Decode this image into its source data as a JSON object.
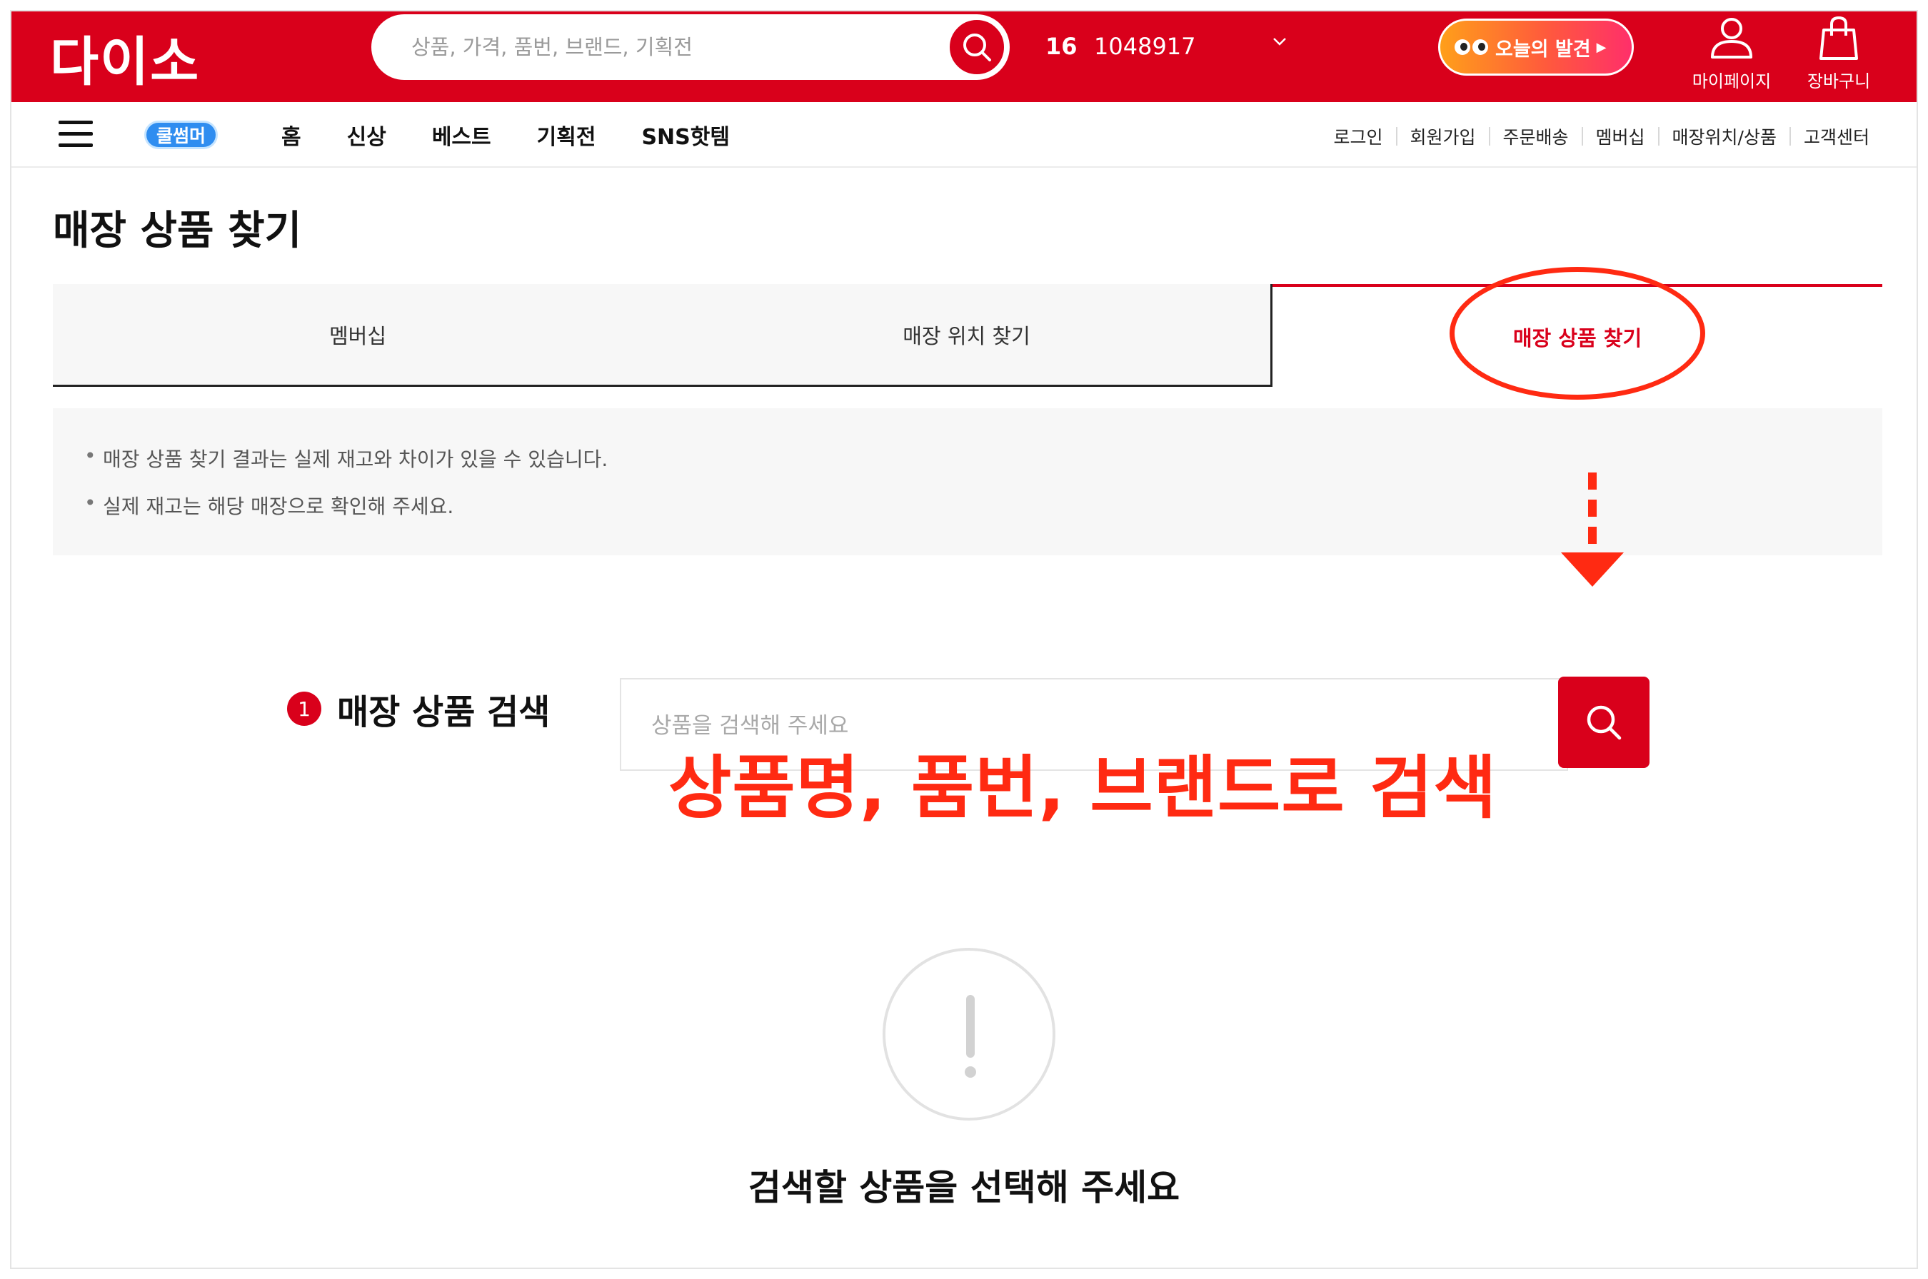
{
  "header": {
    "logo": "다이소",
    "search_placeholder": "상품, 가격, 품번, 브랜드, 기획전",
    "info_num1": "16",
    "info_num2": "1048917",
    "discover_label": "오늘의 발견",
    "mypage_label": "마이페이지",
    "cart_label": "장바구니"
  },
  "nav": {
    "promo_badge": "쿨썸머",
    "main": [
      "홈",
      "신상",
      "베스트",
      "기획전",
      "SNS핫템"
    ],
    "util": [
      "로그인",
      "회원가입",
      "주문배송",
      "멤버십",
      "매장위치/상품",
      "고객센터"
    ]
  },
  "page": {
    "title": "매장 상품 찾기",
    "tabs": [
      "멤버십",
      "매장 위치 찾기",
      "매장 상품 찾기"
    ],
    "active_tab": 2,
    "notices": [
      "매장 상품 찾기 결과는 실제 재고와 차이가 있을 수 있습니다.",
      "실제 재고는 해당 매장으로 확인해 주세요."
    ]
  },
  "search_section": {
    "step_number": "1",
    "label": "매장 상품 검색",
    "placeholder": "상품을 검색해 주세요",
    "value": ""
  },
  "empty_state": {
    "message": "검색할 상품을 선택해 주세요"
  },
  "annotation": {
    "text": "상품명, 품번, 브랜드로 검색",
    "color": "#ff2a12"
  },
  "colors": {
    "brand_red": "#d9001b",
    "annotation_red": "#ff2a12"
  },
  "icons": {
    "search": "search-icon",
    "chevron": "chevron-down-icon",
    "user": "user-icon",
    "cart": "shopping-bag-icon",
    "menu": "hamburger-menu-icon",
    "alert": "exclamation-icon"
  }
}
